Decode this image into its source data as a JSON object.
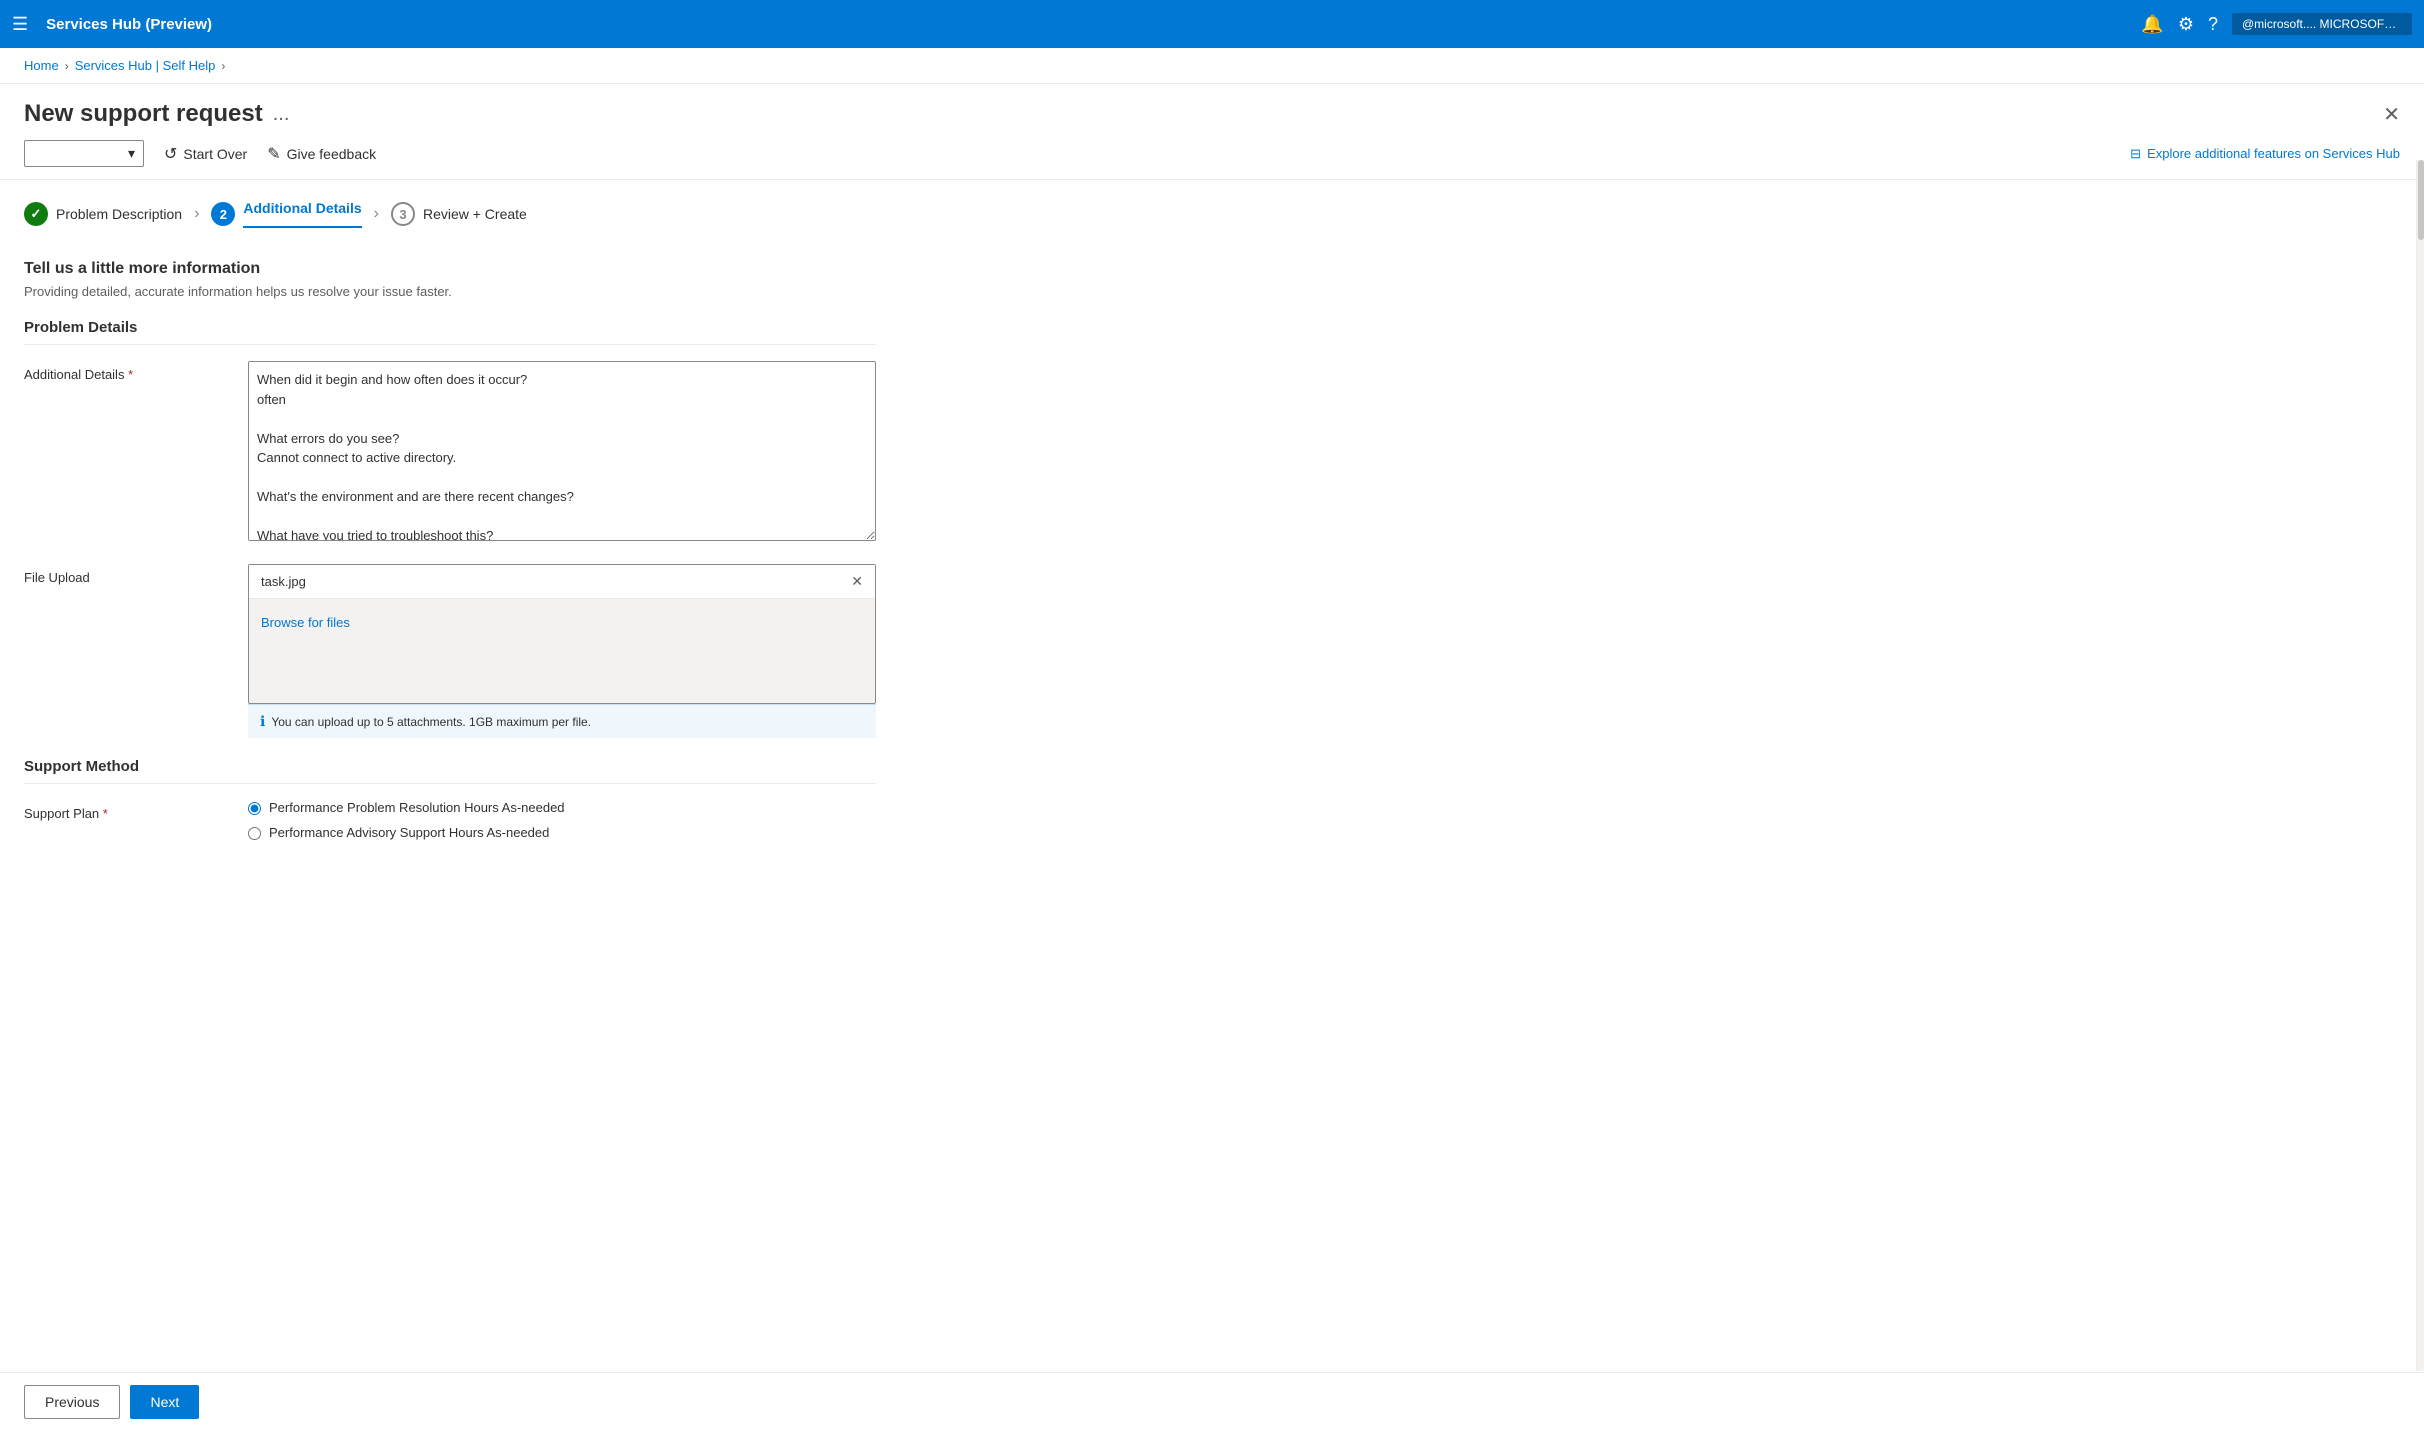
{
  "topbar": {
    "hamburger_icon": "☰",
    "title": "Services Hub (Preview)",
    "bell_icon": "🔔",
    "gear_icon": "⚙",
    "question_icon": "?",
    "user_label": "@microsoft.... MICROSOFT (MICROSOFT.ONMI..."
  },
  "breadcrumb": {
    "items": [
      "Home",
      "Services Hub | Self Help"
    ],
    "separators": [
      ">",
      ">"
    ]
  },
  "page": {
    "title": "New support request",
    "dots": "...",
    "close_icon": "✕"
  },
  "toolbar": {
    "dropdown_placeholder": "",
    "dropdown_icon": "▾",
    "start_over_icon": "↺",
    "start_over_label": "Start Over",
    "feedback_icon": "✎",
    "feedback_label": "Give feedback",
    "explore_icon": "⊟",
    "explore_label": "Explore additional features on Services Hub"
  },
  "steps": [
    {
      "id": "problem-description",
      "number": "✓",
      "label": "Problem Description",
      "state": "complete"
    },
    {
      "id": "additional-details",
      "number": "2",
      "label": "Additional Details",
      "state": "active"
    },
    {
      "id": "review-create",
      "number": "3",
      "label": "Review + Create",
      "state": "inactive"
    }
  ],
  "form": {
    "section_title": "Tell us a little more information",
    "section_subtitle": "Providing detailed, accurate information helps us resolve your issue faster.",
    "problem_details_header": "Problem Details",
    "additional_details_label": "Additional Details",
    "additional_details_required": "*",
    "additional_details_value": "When did it begin and how often does it occur?\noften\n\nWhat errors do you see?\nCannot connect to active directory.\n\nWhat's the environment and are there recent changes?\n\nWhat have you tried to troubleshoot this?\nYes",
    "file_upload_label": "File Upload",
    "file_upload_filename": "task.jpg",
    "file_upload_close_icon": "✕",
    "browse_link_label": "Browse for files",
    "file_upload_info": "You can upload up to 5 attachments. 1GB maximum per file.",
    "info_icon": "ℹ",
    "support_method_header": "Support Method",
    "support_plan_label": "Support Plan",
    "support_plan_required": "*",
    "support_plan_options": [
      {
        "id": "perf-resolution",
        "label": "Performance Problem Resolution Hours As-needed",
        "selected": true
      },
      {
        "id": "proactive-advisory",
        "label": "Performance Advisory Support Hours As-needed",
        "selected": false
      }
    ]
  },
  "nav": {
    "previous_label": "Previous",
    "next_label": "Next"
  }
}
